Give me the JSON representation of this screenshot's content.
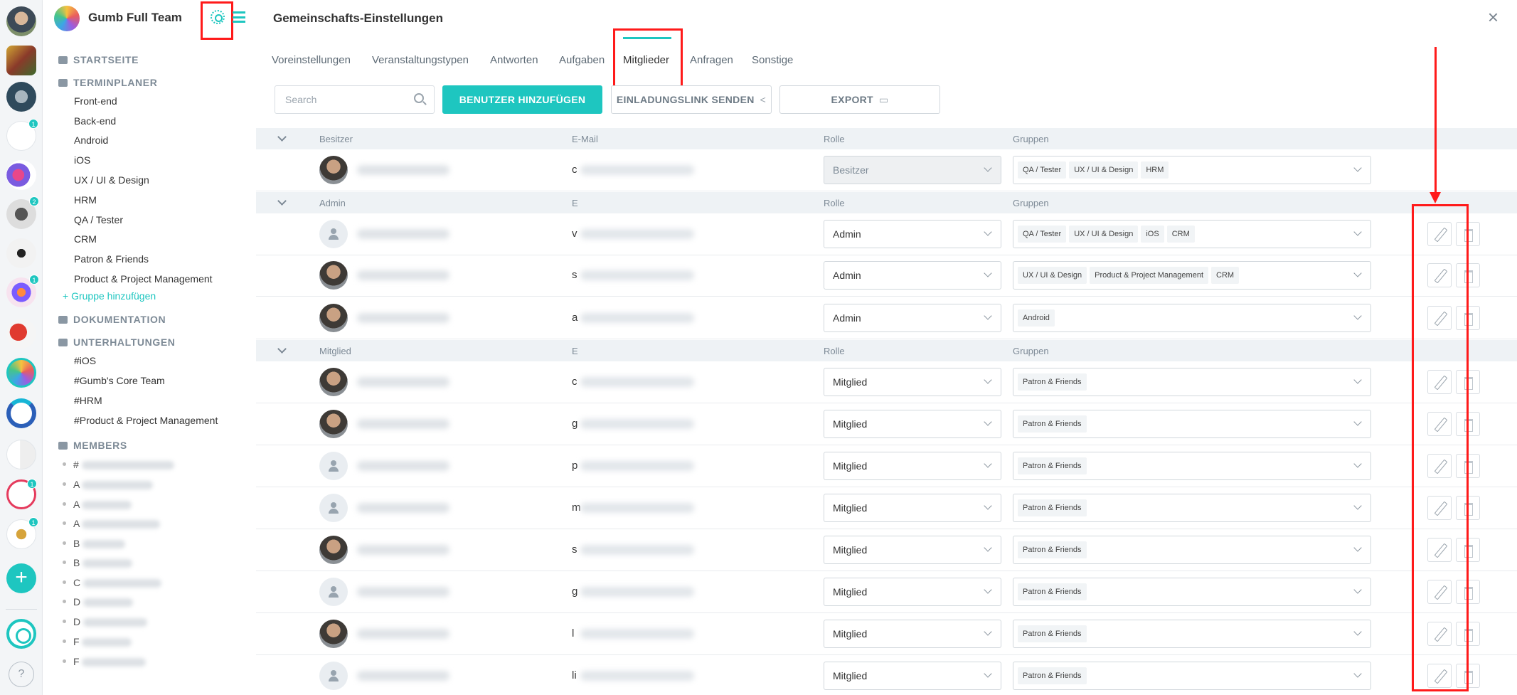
{
  "team": {
    "name": "Gumb Full Team"
  },
  "rail": {
    "badges": [
      "1",
      "2",
      "1",
      "1",
      "1"
    ],
    "add_label": "+",
    "help_label": "?"
  },
  "sidebar": {
    "home": "STARTSEITE",
    "scheduler": "TERMINPLANER",
    "groups": [
      "Front-end",
      "Back-end",
      "Android",
      "iOS",
      "UX / UI & Design",
      "HRM",
      "QA / Tester",
      "CRM",
      "Patron & Friends",
      "Product & Project Management"
    ],
    "add_group": "+ Gruppe hinzufügen",
    "docs": "DOKUMENTATION",
    "conversations": "UNTERHALTUNGEN",
    "channels": [
      "#iOS",
      "#Gumb's Core Team",
      "#HRM",
      "#Product & Project Management"
    ],
    "members_header": "MEMBERS",
    "members": [
      "#",
      "A",
      "A",
      "A",
      "B",
      "B",
      "C",
      "D",
      "D",
      "F",
      "F"
    ]
  },
  "main": {
    "title": "Gemeinschafts-Einstellungen",
    "close": "×",
    "tabs": [
      "Voreinstellungen",
      "Veranstaltungstypen",
      "Antworten",
      "Aufgaben",
      "Mitglieder",
      "Anfragen",
      "Sonstige"
    ],
    "active_tab": "Mitglieder",
    "search_placeholder": "Search",
    "add_user": "BENUTZER HINZUFÜGEN",
    "invite": "EINLADUNGSLINK SENDEN",
    "export": "EXPORT"
  },
  "table": {
    "col_role": "Rolle",
    "col_groups": "Gruppen",
    "sections": [
      {
        "label": "Besitzer",
        "email_header": "E-Mail",
        "rows": [
          {
            "email_first": "c",
            "role": "Besitzer",
            "groups": [
              "QA / Tester",
              "UX / UI & Design",
              "HRM"
            ]
          }
        ]
      },
      {
        "label": "Admin",
        "email_header": "E",
        "rows": [
          {
            "email_first": "v",
            "role": "Admin",
            "groups": [
              "QA / Tester",
              "UX / UI & Design",
              "iOS",
              "CRM"
            ]
          },
          {
            "email_first": "s",
            "role": "Admin",
            "groups": [
              "UX / UI & Design",
              "Product & Project Management",
              "CRM"
            ]
          },
          {
            "email_first": "a",
            "role": "Admin",
            "groups": [
              "Android"
            ]
          }
        ]
      },
      {
        "label": "Mitglied",
        "email_header": "E",
        "rows": [
          {
            "email_first": "c",
            "role": "Mitglied",
            "groups": [
              "Patron & Friends"
            ]
          },
          {
            "email_first": "g",
            "role": "Mitglied",
            "groups": [
              "Patron & Friends"
            ]
          },
          {
            "email_first": "p",
            "role": "Mitglied",
            "groups": [
              "Patron & Friends"
            ]
          },
          {
            "email_first": "m",
            "role": "Mitglied",
            "groups": [
              "Patron & Friends"
            ]
          },
          {
            "email_first": "s",
            "role": "Mitglied",
            "groups": [
              "Patron & Friends"
            ]
          },
          {
            "email_first": "g",
            "role": "Mitglied",
            "groups": [
              "Patron & Friends"
            ]
          },
          {
            "email_first": "l",
            "role": "Mitglied",
            "groups": [
              "Patron & Friends"
            ]
          },
          {
            "email_first": "li",
            "role": "Mitglied",
            "groups": [
              "Patron & Friends"
            ]
          }
        ]
      }
    ]
  },
  "colors": {
    "accent": "#1ec6c0",
    "annotation": "#ff1a1a"
  }
}
